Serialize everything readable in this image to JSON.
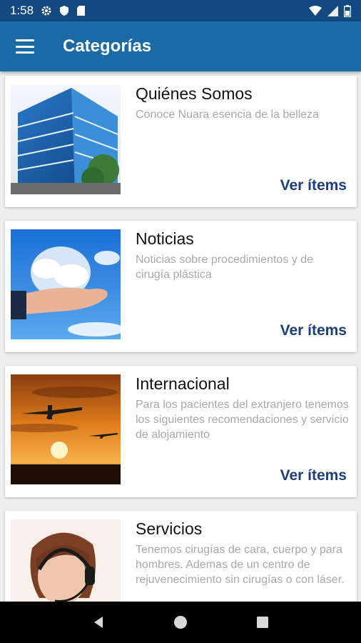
{
  "status_bar": {
    "time": "1:58"
  },
  "app_bar": {
    "title": "Categorías"
  },
  "categories": [
    {
      "title": "Quiénes Somos",
      "description": "Conoce Nuara esencia de la belleza",
      "action": "Ver ítems"
    },
    {
      "title": "Noticias",
      "description": "Noticias sobre procedimientos y de cirugía plástica",
      "action": "Ver ítems"
    },
    {
      "title": "Internacional",
      "description": "Para los pacientes del extranjero tenemos los siguientes recomendaciones y servicio de alojamiento",
      "action": "Ver ítems"
    },
    {
      "title": "Servicios",
      "description": "Tenemos cirugías de cara, cuerpo y para hombres. Ademas de un centro de rejuvenecimiento sin cirugías o con láser.",
      "action": ""
    }
  ],
  "colors": {
    "status_bar": "#124a80",
    "app_bar": "#1b6aa5",
    "action_text": "#1d3e7a"
  }
}
